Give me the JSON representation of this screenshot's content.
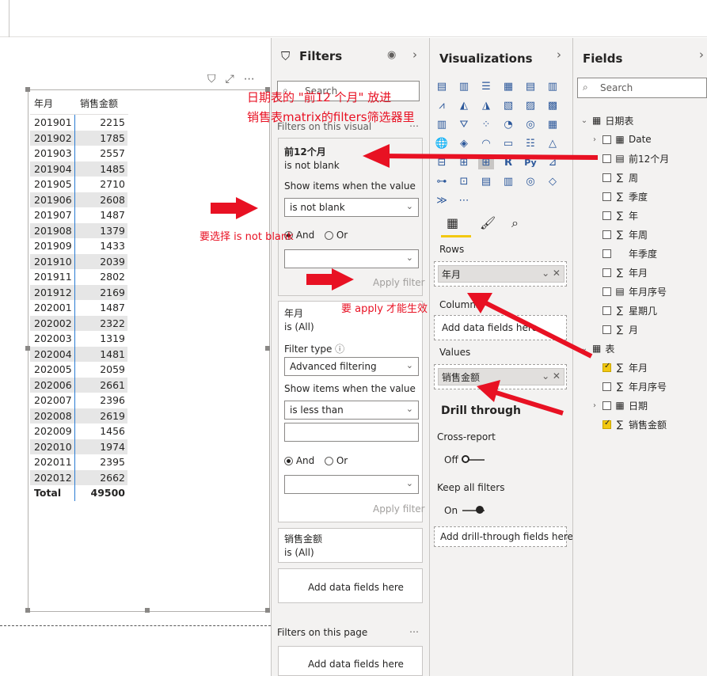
{
  "matrix": {
    "headers": [
      "年月",
      "销售金额"
    ],
    "rows": [
      [
        "201901",
        "2215"
      ],
      [
        "201902",
        "1785"
      ],
      [
        "201903",
        "2557"
      ],
      [
        "201904",
        "1485"
      ],
      [
        "201905",
        "2710"
      ],
      [
        "201906",
        "2608"
      ],
      [
        "201907",
        "1487"
      ],
      [
        "201908",
        "1379"
      ],
      [
        "201909",
        "1433"
      ],
      [
        "201910",
        "2039"
      ],
      [
        "201911",
        "2802"
      ],
      [
        "201912",
        "2169"
      ],
      [
        "202001",
        "1487"
      ],
      [
        "202002",
        "2322"
      ],
      [
        "202003",
        "1319"
      ],
      [
        "202004",
        "1481"
      ],
      [
        "202005",
        "2059"
      ],
      [
        "202006",
        "2661"
      ],
      [
        "202007",
        "2396"
      ],
      [
        "202008",
        "2619"
      ],
      [
        "202009",
        "1456"
      ],
      [
        "202010",
        "1974"
      ],
      [
        "202011",
        "2395"
      ],
      [
        "202012",
        "2662"
      ]
    ],
    "total_label": "Total",
    "total_value": "49500"
  },
  "filters": {
    "title": "Filters",
    "search_placeholder": "Search",
    "on_visual_label": "Filters on this visual",
    "card1": {
      "name": "前12个月",
      "state": "is not blank",
      "show_items": "Show items when the value",
      "condition": "is not blank",
      "and": "And",
      "or": "Or",
      "apply": "Apply filter"
    },
    "card2": {
      "name": "年月",
      "state": "is (All)",
      "filter_type_label": "Filter type",
      "filter_type": "Advanced filtering",
      "show_items": "Show items when the value",
      "condition": "is less than",
      "and": "And",
      "or": "Or",
      "apply": "Apply filter"
    },
    "card3": {
      "name": "销售金额",
      "state": "is (All)"
    },
    "add_fields": "Add data fields here",
    "on_page_label": "Filters on this page",
    "add_fields_page": "Add data fields here"
  },
  "visualizations": {
    "title": "Visualizations",
    "rows_label": "Rows",
    "rows_field": "年月",
    "columns_label": "Columns",
    "columns_placeholder": "Add data fields here",
    "values_label": "Values",
    "values_field": "销售金额",
    "drill_title": "Drill through",
    "cross_report": "Cross-report",
    "cross_state": "Off",
    "keep_filters": "Keep all filters",
    "keep_state": "On",
    "drill_placeholder": "Add drill-through fields here",
    "r_icon": "R",
    "py_icon": "Py"
  },
  "fields": {
    "title": "Fields",
    "search_placeholder": "Search",
    "table1": "日期表",
    "table1_fields": [
      "Date",
      "前12个月",
      "周",
      "季度",
      "年",
      "年周",
      "年季度",
      "年月",
      "年月序号",
      "星期几",
      "月"
    ],
    "table2": "表",
    "table2_fields": [
      "年月",
      "年月序号",
      "日期",
      "销售金额"
    ]
  },
  "annotations": {
    "note1": "日期表的 \"前12 个月\" 放进",
    "note2": "销售表matrix的filters筛选器里",
    "note3": "要选择 is not blank",
    "note4": "要 apply 才能生效"
  },
  "colors": {
    "accent_red": "#e81123",
    "selected_yellow": "#f2c811",
    "pane_bg": "#f3f2f1"
  }
}
